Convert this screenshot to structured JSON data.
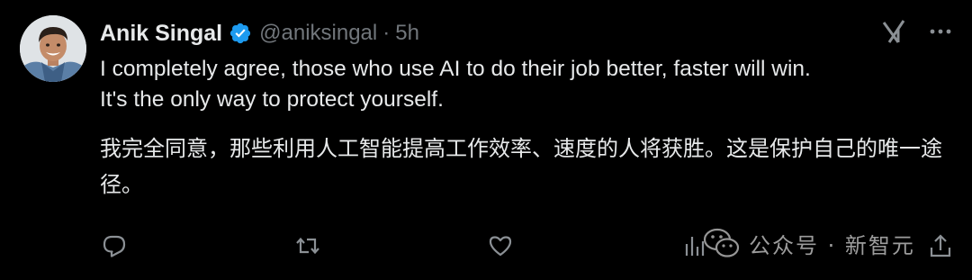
{
  "tweet": {
    "author": {
      "name": "Anik Singal",
      "handle": "@aniksingal",
      "separator": "·",
      "time": "5h"
    },
    "text_en": "I completely agree, those who use AI to do their job better, faster will win.\nIt's the only way to protect yourself.",
    "text_zh": "我完全同意，那些利用人工智能提高工作效率、速度的人将获胜。这是保护自己的唯一途径。"
  },
  "watermark": {
    "text": "公众号 · 新智元"
  },
  "colors": {
    "background": "#000000",
    "text": "#e7e9ea",
    "secondary": "#71767b",
    "verified": "#1d9bf0"
  },
  "icons": {
    "verified": "verified-badge-icon",
    "grok": "grok-icon",
    "more": "more-icon",
    "reply": "reply-icon",
    "retweet": "retweet-icon",
    "like": "like-icon",
    "views": "views-icon",
    "share": "share-icon"
  }
}
